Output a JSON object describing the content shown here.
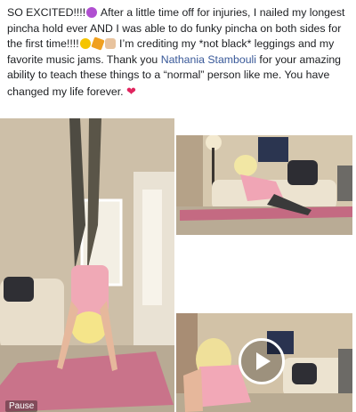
{
  "post": {
    "p1": "SO EXCITED!!!!",
    "p2": " After a little time off for injuries, I nailed my longest pincha hold ever AND I was able to do funky pincha on both sides for the first time!!!!",
    "p3": " I’m crediting my *not black* leggings and my favorite music jams. Thank you ",
    "mention": "Nathania Stambouli",
    "p4": " for your amazing ability to teach these things to a “normal” person like me. You have changed my life forever. ",
    "heart": "❤",
    "mention_color": "#385898",
    "heart_color": "#e0245e"
  },
  "media": {
    "pause_label": "Pause"
  }
}
